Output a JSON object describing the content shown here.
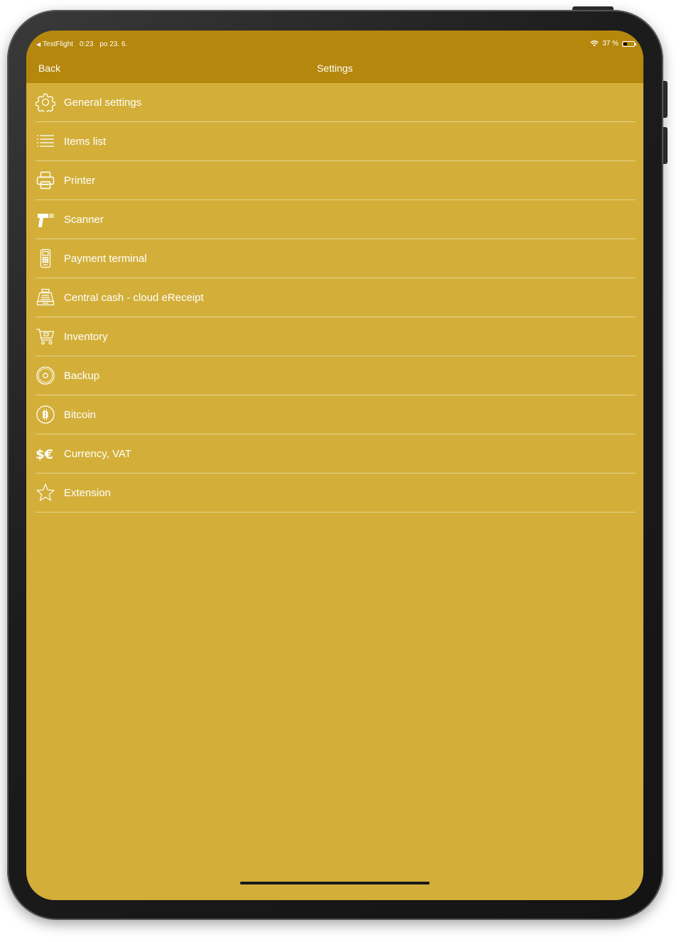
{
  "status": {
    "app_back": "TestFlight",
    "time": "0:23",
    "date": "po 23. 6.",
    "battery": "37 %",
    "battery_level": 0.37
  },
  "nav": {
    "back_label": "Back",
    "title": "Settings"
  },
  "items": [
    {
      "label": "General settings",
      "icon": "gear-icon"
    },
    {
      "label": "Items list",
      "icon": "list-icon"
    },
    {
      "label": "Printer",
      "icon": "printer-icon"
    },
    {
      "label": "Scanner",
      "icon": "scanner-icon"
    },
    {
      "label": "Payment terminal",
      "icon": "payment-terminal-icon"
    },
    {
      "label": "Central cash - cloud eReceipt",
      "icon": "cash-register-icon"
    },
    {
      "label": "Inventory",
      "icon": "cart-icon"
    },
    {
      "label": "Backup",
      "icon": "disc-icon"
    },
    {
      "label": "Bitcoin",
      "icon": "bitcoin-icon"
    },
    {
      "label": "Currency, VAT",
      "icon": "currency-icon"
    },
    {
      "label": "Extension",
      "icon": "star-icon"
    }
  ],
  "colors": {
    "background": "#d3af39",
    "header": "#b5870c",
    "text": "#ffffff"
  }
}
